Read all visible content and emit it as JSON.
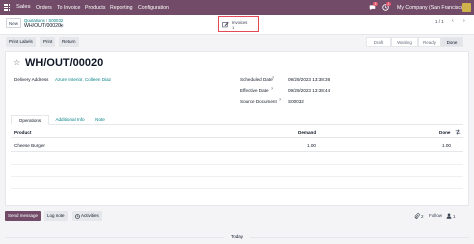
{
  "topbar": {
    "app_name": "Sales",
    "menu": [
      "Orders",
      "To Invoice",
      "Products",
      "Reporting",
      "Configuration"
    ],
    "chat_badge": "5",
    "activity_badge": "1",
    "company": "My Company (San Francisco)"
  },
  "control": {
    "new_label": "New",
    "breadcrumb_parent": "Quotations",
    "breadcrumb_sep": "/",
    "breadcrumb_order": "S00032",
    "record_name": "WH/OUT/00020",
    "stat_label": "Invoices",
    "stat_count": "1",
    "pager": "1 / 1"
  },
  "actions": {
    "print_labels": "Print Labels",
    "print": "Print",
    "return": "Return"
  },
  "status": {
    "steps": [
      "Draft",
      "Waiting",
      "Ready",
      "Done"
    ],
    "active": "Done"
  },
  "form": {
    "title": "WH/OUT/00020",
    "delivery_address_label": "Delivery Address",
    "delivery_address_value": "Azure Interior, Colleen Diaz",
    "scheduled_date_label": "Scheduled Date",
    "scheduled_date_value": "09/29/2023 13:38:36",
    "effective_date_label": "Effective Date",
    "effective_date_value": "09/29/2023 13:38:44",
    "source_document_label": "Source Document",
    "source_document_value": "S00032",
    "help_mark": "?"
  },
  "tabs": [
    "Operations",
    "Additional Info",
    "Note"
  ],
  "table": {
    "headers": {
      "product": "Product",
      "demand": "Demand",
      "done": "Done"
    },
    "rows": [
      {
        "product": "Cheese Burger",
        "demand": "1.00",
        "done": "1.00"
      }
    ]
  },
  "chatter": {
    "send_message": "Send message",
    "log_note": "Log note",
    "activities": "Activities",
    "attachments_count": "2",
    "follow": "Follow",
    "followers_count": "1",
    "today": "Today"
  },
  "colors": {
    "brand": "#714b67",
    "link": "#017e84",
    "highlight_box": "#e24a55"
  }
}
